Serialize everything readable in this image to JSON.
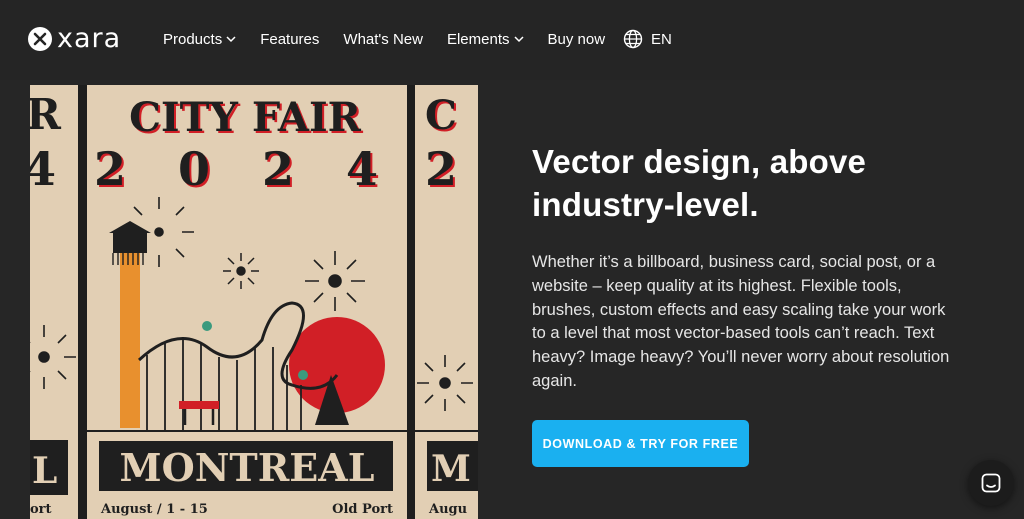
{
  "header": {
    "logo_text": "xara",
    "nav": [
      {
        "label": "Products",
        "dropdown": true
      },
      {
        "label": "Features",
        "dropdown": false
      },
      {
        "label": "What's New",
        "dropdown": false
      },
      {
        "label": "Elements",
        "dropdown": true
      },
      {
        "label": "Buy now",
        "dropdown": false
      }
    ],
    "language": "EN"
  },
  "poster": {
    "title": "CITY FAIR",
    "year": "2 0 2 4",
    "city": "MONTREAL",
    "date": "August / 1 - 15",
    "venue": "Old Port",
    "side_left_year": "4",
    "side_left_city": "L",
    "side_left_venue": "ort",
    "side_left_title": "R",
    "side_right_title": "C",
    "side_right_year": "2",
    "side_right_city": "M",
    "side_right_venue": "Augu",
    "colors": {
      "paper": "#e2cfb4",
      "ink": "#1f1f1f",
      "red": "#d11f26",
      "orange": "#e8902e",
      "teal": "#3a9a7e"
    }
  },
  "hero": {
    "title": "Vector design, above industry-level.",
    "body": "Whether it’s a billboard, business card, social post, or a website – keep quality at its highest. Flexible tools, brushes, custom effects and easy scaling take your work to a level that most vector-based tools can’t reach. Text heavy? Image heavy? You’ll never worry about resolution again.",
    "cta": "DOWNLOAD & TRY FOR FREE",
    "cta_color": "#1ab0f0"
  },
  "chat": {
    "icon": "chat-icon"
  }
}
